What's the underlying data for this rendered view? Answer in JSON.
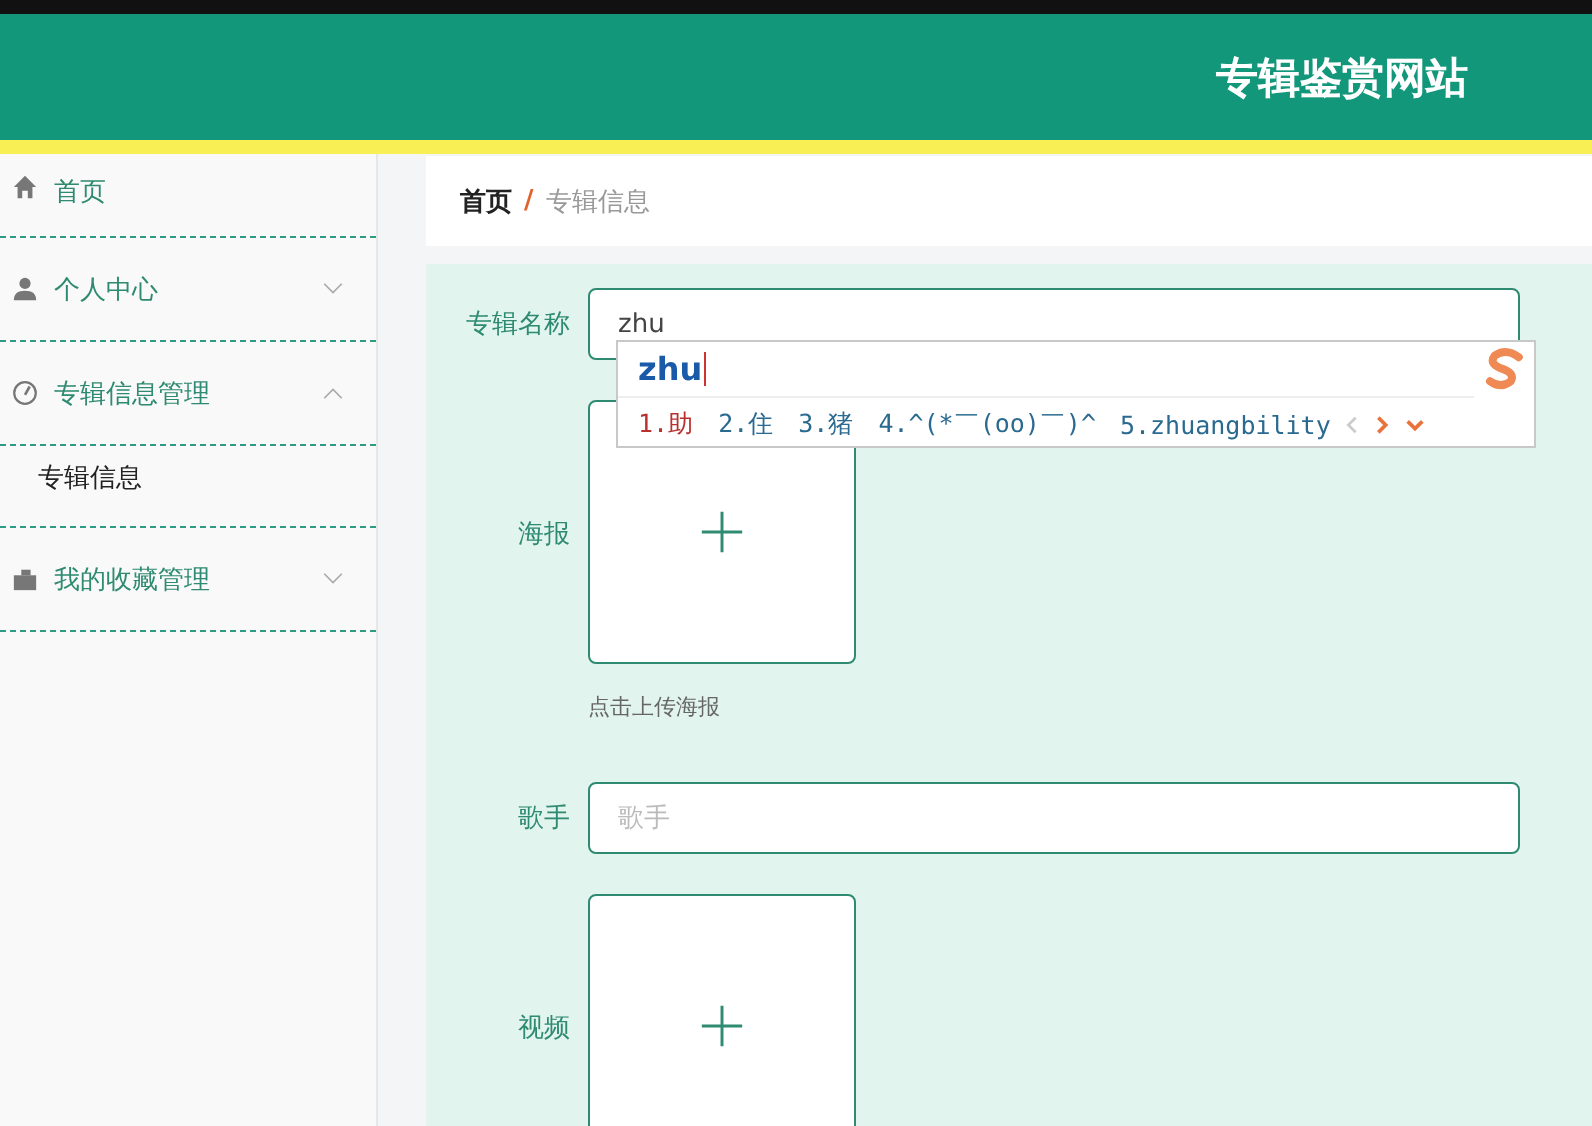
{
  "header": {
    "title": "专辑鉴赏网站"
  },
  "sidebar": {
    "items": [
      {
        "label": "首页"
      },
      {
        "label": "个人中心",
        "expanded": false
      },
      {
        "label": "专辑信息管理",
        "expanded": true,
        "children": [
          {
            "label": "专辑信息"
          }
        ]
      },
      {
        "label": "我的收藏管理",
        "expanded": false
      }
    ]
  },
  "breadcrumb": {
    "items": [
      "首页",
      "专辑信息"
    ],
    "separator": "/"
  },
  "form": {
    "fields": [
      {
        "kind": "text",
        "label": "专辑名称",
        "value": "zhu"
      },
      {
        "kind": "upload",
        "label": "海报",
        "hint": "点击上传海报"
      },
      {
        "kind": "text",
        "label": "歌手",
        "placeholder": "歌手"
      },
      {
        "kind": "upload",
        "label": "视频"
      }
    ]
  },
  "ime": {
    "composition": "zhu",
    "candidates": [
      {
        "text": "1.助",
        "selected": true
      },
      {
        "text": "2.住",
        "selected": false
      },
      {
        "text": "3.猪",
        "selected": false
      },
      {
        "text": "4.^(*￣(oo)￣)^",
        "selected": false
      },
      {
        "text": "5.zhuangbility",
        "selected": false
      }
    ]
  }
}
